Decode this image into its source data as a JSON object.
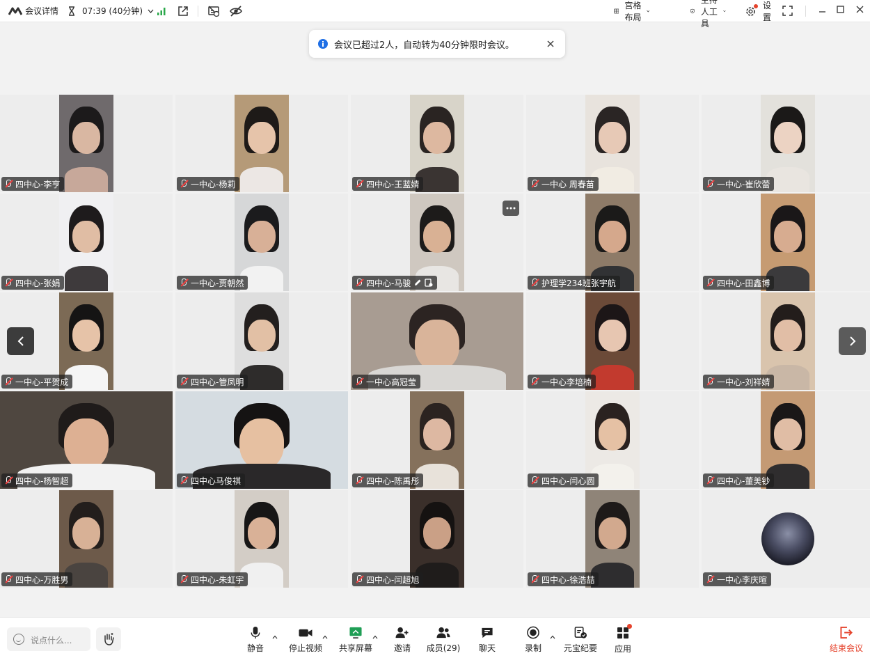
{
  "topbar": {
    "meeting_info": "会议详情",
    "timer": "07:39 (40分钟)",
    "layout": "宫格布局",
    "host_tools": "主持人工具",
    "settings": "设置"
  },
  "notice": {
    "message": "会议已超过2人，自动转为40分钟限时会议。"
  },
  "participants": [
    {
      "name": "四中心-李亨"
    },
    {
      "name": "一中心-杨莉"
    },
    {
      "name": "四中心-王蓝婧"
    },
    {
      "name": "一中心 周春苗"
    },
    {
      "name": "一中心-崔欣蕾"
    },
    {
      "name": "四中心-张娟"
    },
    {
      "name": "一中心-贾朝然"
    },
    {
      "name": "四中心-马骏"
    },
    {
      "name": "护理学234班张宇航"
    },
    {
      "name": "四中心-田鑫博"
    },
    {
      "name": "一中心-平贺成"
    },
    {
      "name": "四中心-管凤明"
    },
    {
      "name": "一中心高冠莹"
    },
    {
      "name": "一中心李培楠"
    },
    {
      "name": "一中心-刘祥婧"
    },
    {
      "name": "四中心-杨智超"
    },
    {
      "name": "四中心马俊祺"
    },
    {
      "name": "四中心-陈禹彤"
    },
    {
      "name": "四中心-闫心圆"
    },
    {
      "name": "四中心-董美钞"
    },
    {
      "name": "四中心-万胜男"
    },
    {
      "name": "四中心-朱虹宇"
    },
    {
      "name": "四中心-闫超旭"
    },
    {
      "name": "四中心-徐浩喆"
    },
    {
      "name": "一中心李庆暄"
    }
  ],
  "bottombar": {
    "chat_placeholder": "说点什么...",
    "mute": "静音",
    "stop_video": "停止视频",
    "share_screen": "共享屏幕",
    "invite": "邀请",
    "members": "成员(29)",
    "chat": "聊天",
    "record": "录制",
    "ai_minutes": "元宝纪要",
    "apps": "应用",
    "end": "结束会议"
  },
  "colors": {
    "accent": "#1f6fe5",
    "end_red": "#e5432c",
    "signal_green": "#2aa84a"
  }
}
